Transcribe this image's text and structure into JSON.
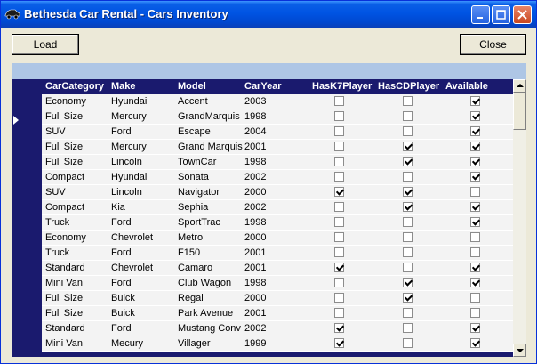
{
  "window": {
    "title": "Bethesda Car Rental - Cars Inventory",
    "icon": "car-icon"
  },
  "toolbar": {
    "load_label": "Load",
    "close_label": "Close"
  },
  "grid": {
    "columns": [
      "CarCategory",
      "Make",
      "Model",
      "CarYear",
      "HasK7Player",
      "HasCDPlayer",
      "Available"
    ],
    "rows": [
      {
        "category": "Economy",
        "make": "Hyundai",
        "model": "Accent",
        "year": "2003",
        "k7": false,
        "cd": false,
        "available": true
      },
      {
        "category": "Full Size",
        "make": "Mercury",
        "model": "GrandMarquis",
        "year": "1998",
        "k7": false,
        "cd": false,
        "available": true
      },
      {
        "category": "SUV",
        "make": "Ford",
        "model": "Escape",
        "year": "2004",
        "k7": false,
        "cd": false,
        "available": true
      },
      {
        "category": "Full Size",
        "make": "Mercury",
        "model": "Grand Marquis",
        "year": "2001",
        "k7": false,
        "cd": true,
        "available": true
      },
      {
        "category": "Full Size",
        "make": "Lincoln",
        "model": "TownCar",
        "year": "1998",
        "k7": false,
        "cd": true,
        "available": true
      },
      {
        "category": "Compact",
        "make": "Hyundai",
        "model": "Sonata",
        "year": "2002",
        "k7": false,
        "cd": false,
        "available": true
      },
      {
        "category": "SUV",
        "make": "Lincoln",
        "model": "Navigator",
        "year": "2000",
        "k7": true,
        "cd": true,
        "available": false
      },
      {
        "category": "Compact",
        "make": "Kia",
        "model": "Sephia",
        "year": "2002",
        "k7": false,
        "cd": true,
        "available": true
      },
      {
        "category": "Truck",
        "make": "Ford",
        "model": "SportTrac",
        "year": "1998",
        "k7": false,
        "cd": false,
        "available": true
      },
      {
        "category": "Economy",
        "make": "Chevrolet",
        "model": "Metro",
        "year": "2000",
        "k7": false,
        "cd": false,
        "available": false
      },
      {
        "category": "Truck",
        "make": "Ford",
        "model": "F150",
        "year": "2001",
        "k7": false,
        "cd": false,
        "available": false
      },
      {
        "category": "Standard",
        "make": "Chevrolet",
        "model": "Camaro",
        "year": "2001",
        "k7": true,
        "cd": false,
        "available": true
      },
      {
        "category": "Mini Van",
        "make": "Ford",
        "model": "Club Wagon",
        "year": "1998",
        "k7": false,
        "cd": true,
        "available": true
      },
      {
        "category": "Full Size",
        "make": "Buick",
        "model": "Regal",
        "year": "2000",
        "k7": false,
        "cd": true,
        "available": false
      },
      {
        "category": "Full Size",
        "make": "Buick",
        "model": "Park Avenue",
        "year": "2001",
        "k7": false,
        "cd": false,
        "available": false
      },
      {
        "category": "Standard",
        "make": "Ford",
        "model": "Mustang Conv",
        "year": "2002",
        "k7": true,
        "cd": false,
        "available": true
      },
      {
        "category": "Mini Van",
        "make": "Mecury",
        "model": "Villager",
        "year": "1999",
        "k7": true,
        "cd": false,
        "available": true
      }
    ]
  },
  "colors": {
    "titlebar": "#0054e3",
    "grid_header": "#1a1a6e",
    "caption_band": "#aec6e5",
    "row_bg": "#f3f3f3"
  }
}
